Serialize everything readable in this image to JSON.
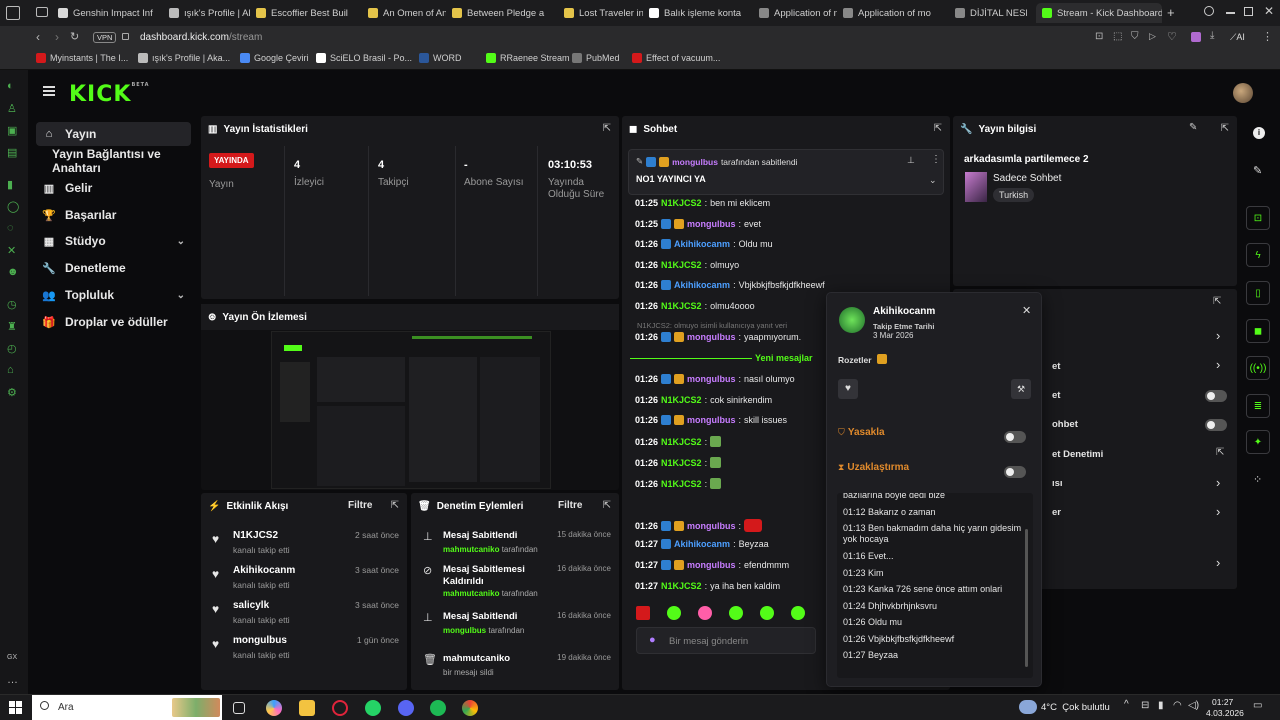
{
  "browser": {
    "tabs": [
      {
        "label": "Genshin Impact Inf",
        "color": "#d9d9d9"
      },
      {
        "label": "ışık's Profile | Aka",
        "color": "#bbbbbb"
      },
      {
        "label": "Escoffier Best Buil",
        "color": "#e4c44a"
      },
      {
        "label": "An Omen of Annih",
        "color": "#e4c44a"
      },
      {
        "label": "Between Pledge a",
        "color": "#e4c44a"
      },
      {
        "label": "Lost Traveler in th",
        "color": "#e4c44a"
      },
      {
        "label": "Balık işleme konta",
        "color": "#ffffff"
      },
      {
        "label": "Application of mo",
        "color": "#888888"
      },
      {
        "label": "Application of mo",
        "color": "#888888"
      },
      {
        "label": "DİJİTAL NESNE TA",
        "color": "#888888"
      }
    ],
    "active_tab": "Stream - Kick Dashboard",
    "new_tab": "+",
    "url_domain": "dashboard.kick.com",
    "url_path": "/stream",
    "vpn_label": "VPN",
    "ai_label": "AI",
    "bookmarks": [
      "Myinstants | The I...",
      "ışık's Profile | Aka...",
      "Google Çeviri",
      "SciELO Brasil - Po...",
      "WORD",
      "RRaenee Stream -...",
      "PubMed",
      "Effect of vacuum..."
    ]
  },
  "kick": {
    "logo": "KICK",
    "logo_beta": "BETA",
    "nav": [
      {
        "label": "Yayın",
        "icon": "home-icon",
        "active": true
      },
      {
        "label": "Yayın Bağlantısı ve Anahtarı",
        "sub": true
      },
      {
        "label": "Gelir",
        "icon": "chart-icon"
      },
      {
        "label": "Başarılar",
        "icon": "trophy-icon"
      },
      {
        "label": "Stüdyo",
        "icon": "studio-icon",
        "chevron": true
      },
      {
        "label": "Denetleme",
        "icon": "wrench-icon"
      },
      {
        "label": "Topluluk",
        "icon": "community-icon",
        "chevron": true
      },
      {
        "label": "Droplar ve ödüller",
        "icon": "gift-icon"
      }
    ],
    "stats": {
      "title": "Yayın İstatistikleri",
      "live_badge": "YAYINDA",
      "live_label": "Yayın",
      "viewers": "4",
      "viewers_label": "İzleyici",
      "followers": "4",
      "followers_label": "Takipçi",
      "subs": "-",
      "subs_label": "Abone Sayısı",
      "uptime": "03:10:53",
      "uptime_label_1": "Yayında",
      "uptime_label_2": "Olduğu Süre"
    },
    "preview_title": "Yayın Ön İzlemesi",
    "activity": {
      "title": "Etkinlik Akışı",
      "filter": "Filtre",
      "items": [
        {
          "name": "N1KJCS2",
          "sub": "kanalı takip etti",
          "time": "2 saat önce"
        },
        {
          "name": "Akihikocanm",
          "sub": "kanalı takip etti",
          "time": "3 saat önce"
        },
        {
          "name": "salicylk",
          "sub": "kanalı takip etti",
          "time": "3 saat önce"
        },
        {
          "name": "mongulbus",
          "sub": "kanalı takip etti",
          "time": "1 gün önce"
        }
      ]
    },
    "modactions": {
      "title": "Denetim Eylemleri",
      "filter": "Filtre",
      "items": [
        {
          "title": "Mesaj Sabitlendi",
          "user": "mahmutcaniko",
          "suffix": "tarafından",
          "time": "15 dakika önce"
        },
        {
          "title": "Mesaj Sabitlemesi Kaldırıldı",
          "user": "mahmutcaniko",
          "suffix": "tarafından",
          "time": "16 dakika önce"
        },
        {
          "title": "Mesaj Sabitlendi",
          "user": "mongulbus",
          "suffix": "tarafından",
          "time": "16 dakika önce"
        },
        {
          "title": "mahmutcaniko",
          "user": "",
          "suffix": "bir mesajı sildi",
          "time": "19 dakika önce"
        }
      ]
    },
    "chat": {
      "title": "Sohbet",
      "pinned_by": "mongulbus",
      "pinned_suffix": "tarafından sabitlendi",
      "pinned_text": "NO1 YAYINCI YA",
      "lines": [
        {
          "t": "01:25",
          "u": "N1KJCS2",
          "c": "g",
          "m": "ben mi eklicem"
        },
        {
          "t": "01:25",
          "u": "mongulbus",
          "c": "p",
          "m": "evet"
        },
        {
          "t": "01:26",
          "u": "Akihikocanm",
          "c": "b",
          "m": "Oldu mu"
        },
        {
          "t": "01:26",
          "u": "N1KJCS2",
          "c": "g",
          "m": "olmuyo"
        },
        {
          "t": "01:26",
          "u": "Akihikocanm",
          "c": "b",
          "m": "Vbjkbkjfbsfkjdfkheewf"
        },
        {
          "t": "01:26",
          "u": "N1KJCS2",
          "c": "g",
          "m": "olmu4oooo"
        }
      ],
      "reply_hint": "N1KJCS2: olmuyo isimli kullanıcıya yanıt veri",
      "line_reply": {
        "t": "01:26",
        "u": "mongulbus",
        "c": "p",
        "m": "yaapmıyorum."
      },
      "new_messages": "Yeni mesajlar",
      "lines2": [
        {
          "t": "01:26",
          "u": "mongulbus",
          "c": "p",
          "m": "nasıl olumyo"
        },
        {
          "t": "01:26",
          "u": "N1KJCS2",
          "c": "g",
          "m": "cok sinirkendim"
        },
        {
          "t": "01:26",
          "u": "mongulbus",
          "c": "p",
          "m": "skill issues"
        },
        {
          "t": "01:26",
          "u": "N1KJCS2",
          "c": "g",
          "m": ""
        },
        {
          "t": "01:26",
          "u": "N1KJCS2",
          "c": "g",
          "m": ""
        },
        {
          "t": "01:26",
          "u": "N1KJCS2",
          "c": "g",
          "m": ""
        },
        {
          "t": "01:26",
          "u": "mongulbus",
          "c": "p",
          "m": ""
        },
        {
          "t": "01:27",
          "u": "Akihikocanm",
          "c": "b",
          "m": "Beyzaa"
        },
        {
          "t": "01:27",
          "u": "mongulbus",
          "c": "p",
          "m": "efendmmm"
        },
        {
          "t": "01:27",
          "u": "N1KJCS2",
          "c": "g",
          "m": "ya iha ben kaldim"
        }
      ],
      "input_placeholder": "Bir mesaj gönderin"
    },
    "info": {
      "title": "Yayın bilgisi",
      "stream_title": "arkadasımla partilemece 2",
      "category": "Sadece Sohbet",
      "language": "Turkish"
    },
    "popup": {
      "username": "Akihikocanm",
      "follow_label": "Takip Etme Tarihi",
      "follow_date": "3 Mar 2026",
      "badges_label": "Rozetler",
      "ban_label": "Yasakla",
      "timeout_label": "Uzaklaştırma",
      "history": [
        "bazılarına böyle dedi bize",
        "01:12 Bakarız o zaman",
        "01:13 Ben bakmadım daha hiç yarın gidesim yok hocaya",
        "01:16 Evet...",
        "01:23 Kim",
        "01:23 Kanka 726 sene önce attım onlari",
        "01:24 Dhjhvkbrhjnksvru",
        "01:26 Oldu mu",
        "01:26 Vbjkbkjfbsfkjdfkheewf",
        "01:27 Beyzaa"
      ]
    },
    "settings_partial": [
      "et",
      "et",
      "ohbet",
      "et Denetimi",
      "ısı",
      "er"
    ]
  },
  "taskbar": {
    "search": "Ara",
    "weather": "4°C  Çok bulutlu",
    "time": "01:27",
    "date": "4.03.2026"
  }
}
